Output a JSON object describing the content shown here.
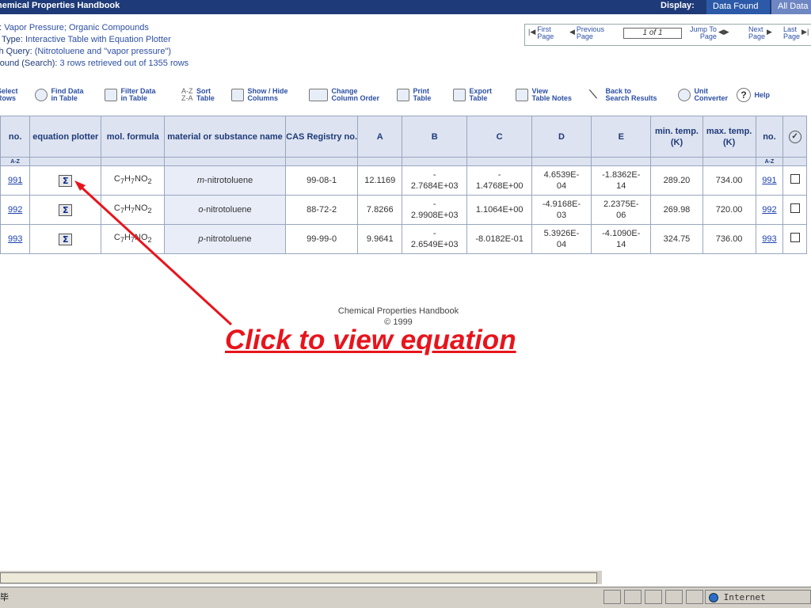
{
  "app": {
    "title": "hemical Properties Handbook",
    "display_label": "Display:",
    "display_tabs": [
      "Data Found",
      "All Data"
    ]
  },
  "info": {
    "table_label": "e: ",
    "table_value": "Vapor Pressure; Organic Compounds",
    "type_label": "e Type: ",
    "type_value": "Interactive Table with Equation Plotter",
    "query_label": "ch Query: ",
    "query_value": "(Nitrotoluene and \"vapor pressure\")",
    "found_label": "Found (Search): ",
    "found_value": "3 rows retrieved out of 1355 rows"
  },
  "pager": {
    "first": [
      "First",
      "Page"
    ],
    "previous": [
      "Previous",
      "Page"
    ],
    "page_box": "1 of 1",
    "jump": [
      "Jump To",
      "Page"
    ],
    "next": [
      "Next",
      "Page"
    ],
    "last": [
      "Last",
      "Page"
    ]
  },
  "toolbar": {
    "select": [
      "Select",
      "Rows"
    ],
    "find": [
      "Find Data",
      "in Table"
    ],
    "filter": [
      "Filter Data",
      "in Table"
    ],
    "sort": [
      "Sort",
      "Table"
    ],
    "sort_icon": [
      "A-Z",
      "Z-A"
    ],
    "showhide": [
      "Show / Hide",
      "Columns"
    ],
    "change": [
      "Change",
      "Column Order"
    ],
    "print": [
      "Print",
      "Table"
    ],
    "export": [
      "Export",
      "Table"
    ],
    "view": [
      "View",
      "Table Notes"
    ],
    "back": [
      "Back to",
      "Search Results"
    ],
    "unit": [
      "Unit",
      "Converter"
    ],
    "help": "Help",
    "help_icon": "?"
  },
  "table": {
    "headers": [
      "no.",
      "equation plotter",
      "mol. formula",
      "material or substance name",
      "CAS Registry no.",
      "A",
      "B",
      "C",
      "D",
      "E",
      "min. temp. (K)",
      "max. temp. (K)",
      "no."
    ],
    "az_label": "A-Z",
    "sigma_symbol": "Σ",
    "check_symbol": "✓",
    "rows": [
      {
        "no": "991",
        "formula": [
          "C",
          "7",
          "H",
          "7",
          "NO",
          "2"
        ],
        "prefix": "m",
        "name": "-nitrotoluene",
        "cas": "99-08-1",
        "A": "12.1169",
        "B": [
          "-",
          "2.7684E+03"
        ],
        "C": [
          "-",
          "1.4768E+00"
        ],
        "D": [
          "4.6539E-",
          "04"
        ],
        "E": [
          "-1.8362E-",
          "14"
        ],
        "tmin": "289.20",
        "tmax": "734.00"
      },
      {
        "no": "992",
        "formula": [
          "C",
          "7",
          "H",
          "7",
          "NO",
          "2"
        ],
        "prefix": "o",
        "name": "-nitrotoluene",
        "cas": "88-72-2",
        "A": "7.8266",
        "B": [
          "-",
          "2.9908E+03"
        ],
        "C": [
          "",
          "1.1064E+00"
        ],
        "D": [
          "-4.9168E-",
          "03"
        ],
        "E": [
          "2.2375E-",
          "06"
        ],
        "tmin": "269.98",
        "tmax": "720.00"
      },
      {
        "no": "993",
        "formula": [
          "C",
          "7",
          "H",
          "7",
          "NO",
          "2"
        ],
        "prefix": "p",
        "name": "-nitrotoluene",
        "cas": "99-99-0",
        "A": "9.9641",
        "B": [
          "-",
          "2.6549E+03"
        ],
        "C": [
          "",
          "-8.0182E-01"
        ],
        "D": [
          "5.3926E-",
          "04"
        ],
        "E": [
          "-4.1090E-",
          "14"
        ],
        "tmin": "324.75",
        "tmax": "736.00"
      }
    ]
  },
  "footer": {
    "line1": "Chemical Properties Handbook",
    "line2": "© 1999"
  },
  "annotation": "Click to view equation",
  "status": {
    "text": "毕",
    "zone": "Internet"
  },
  "colors": {
    "header_bar": "#1e3a78",
    "annotation": "#e8141c",
    "link": "#1a3fae"
  }
}
